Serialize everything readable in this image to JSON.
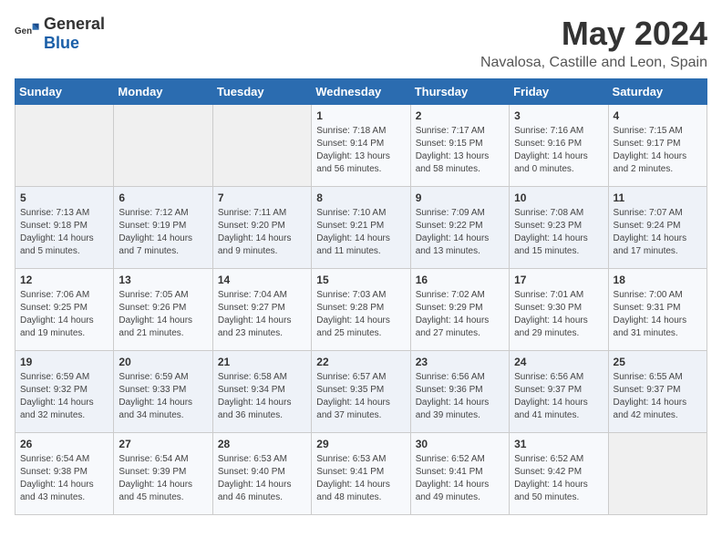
{
  "logo": {
    "text_general": "General",
    "text_blue": "Blue"
  },
  "header": {
    "title": "May 2024",
    "subtitle": "Navalosa, Castille and Leon, Spain"
  },
  "weekdays": [
    "Sunday",
    "Monday",
    "Tuesday",
    "Wednesday",
    "Thursday",
    "Friday",
    "Saturday"
  ],
  "weeks": [
    [
      {
        "day": "",
        "sunrise": "",
        "sunset": "",
        "daylight": ""
      },
      {
        "day": "",
        "sunrise": "",
        "sunset": "",
        "daylight": ""
      },
      {
        "day": "",
        "sunrise": "",
        "sunset": "",
        "daylight": ""
      },
      {
        "day": "1",
        "sunrise": "Sunrise: 7:18 AM",
        "sunset": "Sunset: 9:14 PM",
        "daylight": "Daylight: 13 hours and 56 minutes."
      },
      {
        "day": "2",
        "sunrise": "Sunrise: 7:17 AM",
        "sunset": "Sunset: 9:15 PM",
        "daylight": "Daylight: 13 hours and 58 minutes."
      },
      {
        "day": "3",
        "sunrise": "Sunrise: 7:16 AM",
        "sunset": "Sunset: 9:16 PM",
        "daylight": "Daylight: 14 hours and 0 minutes."
      },
      {
        "day": "4",
        "sunrise": "Sunrise: 7:15 AM",
        "sunset": "Sunset: 9:17 PM",
        "daylight": "Daylight: 14 hours and 2 minutes."
      }
    ],
    [
      {
        "day": "5",
        "sunrise": "Sunrise: 7:13 AM",
        "sunset": "Sunset: 9:18 PM",
        "daylight": "Daylight: 14 hours and 5 minutes."
      },
      {
        "day": "6",
        "sunrise": "Sunrise: 7:12 AM",
        "sunset": "Sunset: 9:19 PM",
        "daylight": "Daylight: 14 hours and 7 minutes."
      },
      {
        "day": "7",
        "sunrise": "Sunrise: 7:11 AM",
        "sunset": "Sunset: 9:20 PM",
        "daylight": "Daylight: 14 hours and 9 minutes."
      },
      {
        "day": "8",
        "sunrise": "Sunrise: 7:10 AM",
        "sunset": "Sunset: 9:21 PM",
        "daylight": "Daylight: 14 hours and 11 minutes."
      },
      {
        "day": "9",
        "sunrise": "Sunrise: 7:09 AM",
        "sunset": "Sunset: 9:22 PM",
        "daylight": "Daylight: 14 hours and 13 minutes."
      },
      {
        "day": "10",
        "sunrise": "Sunrise: 7:08 AM",
        "sunset": "Sunset: 9:23 PM",
        "daylight": "Daylight: 14 hours and 15 minutes."
      },
      {
        "day": "11",
        "sunrise": "Sunrise: 7:07 AM",
        "sunset": "Sunset: 9:24 PM",
        "daylight": "Daylight: 14 hours and 17 minutes."
      }
    ],
    [
      {
        "day": "12",
        "sunrise": "Sunrise: 7:06 AM",
        "sunset": "Sunset: 9:25 PM",
        "daylight": "Daylight: 14 hours and 19 minutes."
      },
      {
        "day": "13",
        "sunrise": "Sunrise: 7:05 AM",
        "sunset": "Sunset: 9:26 PM",
        "daylight": "Daylight: 14 hours and 21 minutes."
      },
      {
        "day": "14",
        "sunrise": "Sunrise: 7:04 AM",
        "sunset": "Sunset: 9:27 PM",
        "daylight": "Daylight: 14 hours and 23 minutes."
      },
      {
        "day": "15",
        "sunrise": "Sunrise: 7:03 AM",
        "sunset": "Sunset: 9:28 PM",
        "daylight": "Daylight: 14 hours and 25 minutes."
      },
      {
        "day": "16",
        "sunrise": "Sunrise: 7:02 AM",
        "sunset": "Sunset: 9:29 PM",
        "daylight": "Daylight: 14 hours and 27 minutes."
      },
      {
        "day": "17",
        "sunrise": "Sunrise: 7:01 AM",
        "sunset": "Sunset: 9:30 PM",
        "daylight": "Daylight: 14 hours and 29 minutes."
      },
      {
        "day": "18",
        "sunrise": "Sunrise: 7:00 AM",
        "sunset": "Sunset: 9:31 PM",
        "daylight": "Daylight: 14 hours and 31 minutes."
      }
    ],
    [
      {
        "day": "19",
        "sunrise": "Sunrise: 6:59 AM",
        "sunset": "Sunset: 9:32 PM",
        "daylight": "Daylight: 14 hours and 32 minutes."
      },
      {
        "day": "20",
        "sunrise": "Sunrise: 6:59 AM",
        "sunset": "Sunset: 9:33 PM",
        "daylight": "Daylight: 14 hours and 34 minutes."
      },
      {
        "day": "21",
        "sunrise": "Sunrise: 6:58 AM",
        "sunset": "Sunset: 9:34 PM",
        "daylight": "Daylight: 14 hours and 36 minutes."
      },
      {
        "day": "22",
        "sunrise": "Sunrise: 6:57 AM",
        "sunset": "Sunset: 9:35 PM",
        "daylight": "Daylight: 14 hours and 37 minutes."
      },
      {
        "day": "23",
        "sunrise": "Sunrise: 6:56 AM",
        "sunset": "Sunset: 9:36 PM",
        "daylight": "Daylight: 14 hours and 39 minutes."
      },
      {
        "day": "24",
        "sunrise": "Sunrise: 6:56 AM",
        "sunset": "Sunset: 9:37 PM",
        "daylight": "Daylight: 14 hours and 41 minutes."
      },
      {
        "day": "25",
        "sunrise": "Sunrise: 6:55 AM",
        "sunset": "Sunset: 9:37 PM",
        "daylight": "Daylight: 14 hours and 42 minutes."
      }
    ],
    [
      {
        "day": "26",
        "sunrise": "Sunrise: 6:54 AM",
        "sunset": "Sunset: 9:38 PM",
        "daylight": "Daylight: 14 hours and 43 minutes."
      },
      {
        "day": "27",
        "sunrise": "Sunrise: 6:54 AM",
        "sunset": "Sunset: 9:39 PM",
        "daylight": "Daylight: 14 hours and 45 minutes."
      },
      {
        "day": "28",
        "sunrise": "Sunrise: 6:53 AM",
        "sunset": "Sunset: 9:40 PM",
        "daylight": "Daylight: 14 hours and 46 minutes."
      },
      {
        "day": "29",
        "sunrise": "Sunrise: 6:53 AM",
        "sunset": "Sunset: 9:41 PM",
        "daylight": "Daylight: 14 hours and 48 minutes."
      },
      {
        "day": "30",
        "sunrise": "Sunrise: 6:52 AM",
        "sunset": "Sunset: 9:41 PM",
        "daylight": "Daylight: 14 hours and 49 minutes."
      },
      {
        "day": "31",
        "sunrise": "Sunrise: 6:52 AM",
        "sunset": "Sunset: 9:42 PM",
        "daylight": "Daylight: 14 hours and 50 minutes."
      },
      {
        "day": "",
        "sunrise": "",
        "sunset": "",
        "daylight": ""
      }
    ]
  ]
}
